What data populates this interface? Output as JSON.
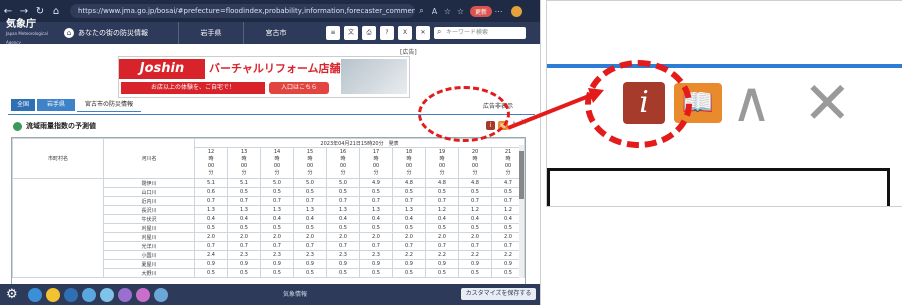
{
  "browser": {
    "url": "https://www.jma.go.jp/bosai/#prefecture=floodindex,probability,information,forecaster_comment,rad...",
    "sync_label": "更新"
  },
  "header": {
    "logo": "気象庁",
    "logo_sub": "Japan Meteorological Agency",
    "home_label": "あなたの街の防災情報",
    "pref_select": "岩手県",
    "city_select": "宮古市",
    "search_placeholder": "キーワード検索",
    "icons": [
      "menu-icon",
      "language-icon",
      "print-icon",
      "help-icon",
      "x-icon",
      "close-icon"
    ]
  },
  "ad": {
    "label": "[広告]",
    "brand": "Joshin",
    "headline": "バーチャルリフォーム店舗",
    "sub": "お店以上の体験を、ご自宅で！",
    "cta": "入口はこちら",
    "hide_label": "広告非表示"
  },
  "breadcrumb": {
    "items": [
      "全国",
      "岩手県",
      "宮古市の防災情報"
    ]
  },
  "section": {
    "title": "流域雨量指数の予測値"
  },
  "table": {
    "timestamp": "2023年04月21日15時20分　発表",
    "col_municipality": "市町村名",
    "col_river": "河川名",
    "hours": [
      {
        "h": "12",
        "a": "時",
        "b": "00",
        "c": "分"
      },
      {
        "h": "13",
        "a": "時",
        "b": "00",
        "c": "分"
      },
      {
        "h": "14",
        "a": "時",
        "b": "00",
        "c": "分"
      },
      {
        "h": "15",
        "a": "時",
        "b": "00",
        "c": "分"
      },
      {
        "h": "16",
        "a": "時",
        "b": "00",
        "c": "分"
      },
      {
        "h": "17",
        "a": "時",
        "b": "00",
        "c": "分"
      },
      {
        "h": "18",
        "a": "時",
        "b": "00",
        "c": "分"
      },
      {
        "h": "19",
        "a": "時",
        "b": "00",
        "c": "分"
      },
      {
        "h": "20",
        "a": "時",
        "b": "00",
        "c": "分"
      },
      {
        "h": "21",
        "a": "時",
        "b": "00",
        "c": "分"
      }
    ],
    "rows": [
      {
        "river": "閉伊川",
        "vals": [
          "5.1",
          "5.1",
          "5.0",
          "5.0",
          "5.0",
          "4.9",
          "4.8",
          "4.8",
          "4.8",
          "4.7"
        ]
      },
      {
        "river": "山口川",
        "vals": [
          "0.6",
          "0.5",
          "0.5",
          "0.5",
          "0.5",
          "0.5",
          "0.5",
          "0.5",
          "0.5",
          "0.5"
        ]
      },
      {
        "river": "近内川",
        "vals": [
          "0.7",
          "0.7",
          "0.7",
          "0.7",
          "0.7",
          "0.7",
          "0.7",
          "0.7",
          "0.7",
          "0.7"
        ]
      },
      {
        "river": "長沢川",
        "vals": [
          "1.3",
          "1.3",
          "1.3",
          "1.3",
          "1.3",
          "1.3",
          "1.3",
          "1.2",
          "1.2",
          "1.2"
        ]
      },
      {
        "river": "牛伏沢",
        "vals": [
          "0.4",
          "0.4",
          "0.4",
          "0.4",
          "0.4",
          "0.4",
          "0.4",
          "0.4",
          "0.4",
          "0.4"
        ]
      },
      {
        "river": "刈屋川",
        "vals": [
          "0.5",
          "0.5",
          "0.5",
          "0.5",
          "0.5",
          "0.5",
          "0.5",
          "0.5",
          "0.5",
          "0.5"
        ]
      },
      {
        "river": "刈屋川",
        "vals": [
          "2.0",
          "2.0",
          "2.0",
          "2.0",
          "2.0",
          "2.0",
          "2.0",
          "2.0",
          "2.0",
          "2.0"
        ]
      },
      {
        "river": "光洋川",
        "vals": [
          "0.7",
          "0.7",
          "0.7",
          "0.7",
          "0.7",
          "0.7",
          "0.7",
          "0.7",
          "0.7",
          "0.7"
        ]
      },
      {
        "river": "小国川",
        "vals": [
          "2.4",
          "2.3",
          "2.3",
          "2.3",
          "2.3",
          "2.3",
          "2.2",
          "2.2",
          "2.2",
          "2.2"
        ]
      },
      {
        "river": "夏屋川",
        "vals": [
          "0.9",
          "0.9",
          "0.9",
          "0.9",
          "0.9",
          "0.9",
          "0.9",
          "0.9",
          "0.9",
          "0.9"
        ]
      },
      {
        "river": "大野川",
        "vals": [
          "0.5",
          "0.5",
          "0.5",
          "0.5",
          "0.5",
          "0.5",
          "0.5",
          "0.5",
          "0.5",
          "0.5"
        ]
      }
    ]
  },
  "bottom": {
    "mid_label": "気象情報",
    "customize_label": "カスタマイズを保存する"
  },
  "zoom": {
    "info_glyph": "i",
    "book_glyph": "📖",
    "up_glyph": "∧",
    "close_glyph": "✕"
  },
  "colors": {
    "highlight": "#e31b1b",
    "header_bg": "#2d3a5a",
    "info_btn": "#a63a2b",
    "book_btn": "#e98b2c"
  }
}
